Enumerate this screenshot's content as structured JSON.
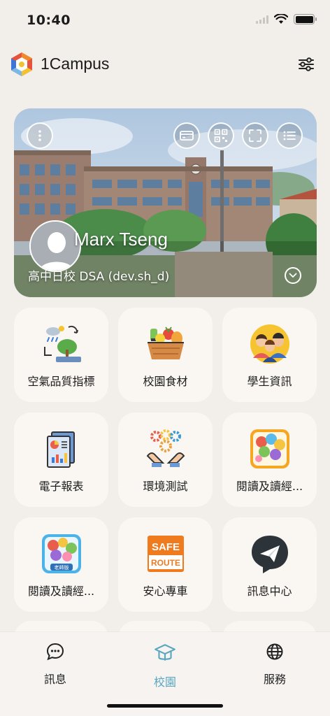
{
  "status_bar": {
    "time": "10:40"
  },
  "header": {
    "app_title": "1Campus",
    "logo": "1campus-logo",
    "settings_icon": "sliders-icon"
  },
  "hero": {
    "user_name": "Marx Tseng",
    "school": "高中日校 DSA (dev.sh_d)",
    "buttons": [
      "more-icon",
      "card-icon",
      "qr-code-icon",
      "scan-icon",
      "list-icon"
    ]
  },
  "apps": [
    {
      "label": "空氣品質指標",
      "icon": "air-quality-icon"
    },
    {
      "label": "校園食材",
      "icon": "food-basket-icon"
    },
    {
      "label": "學生資訊",
      "icon": "students-icon"
    },
    {
      "label": "電子報表",
      "icon": "report-icon"
    },
    {
      "label": "環境測試",
      "icon": "environment-gears-icon"
    },
    {
      "label": "閱讀及讀經...",
      "icon": "reading-app-icon"
    },
    {
      "label": "閱讀及讀經...",
      "icon": "reading-teacher-app-icon"
    },
    {
      "label": "安心專車",
      "icon": "safe-route-icon"
    },
    {
      "label": "訊息中心",
      "icon": "message-center-icon"
    }
  ],
  "safe_route_badge": {
    "top": "SAFE",
    "bottom": "ROUTE",
    "teacher": "老師版"
  },
  "nav": [
    {
      "label": "訊息",
      "icon": "chat-icon"
    },
    {
      "label": "校園",
      "icon": "campus-cap-icon"
    },
    {
      "label": "服務",
      "icon": "globe-icon"
    }
  ],
  "colors": {
    "accent": "#5aa7c0",
    "background": "#f2eeea",
    "tile": "#faf7f3"
  }
}
